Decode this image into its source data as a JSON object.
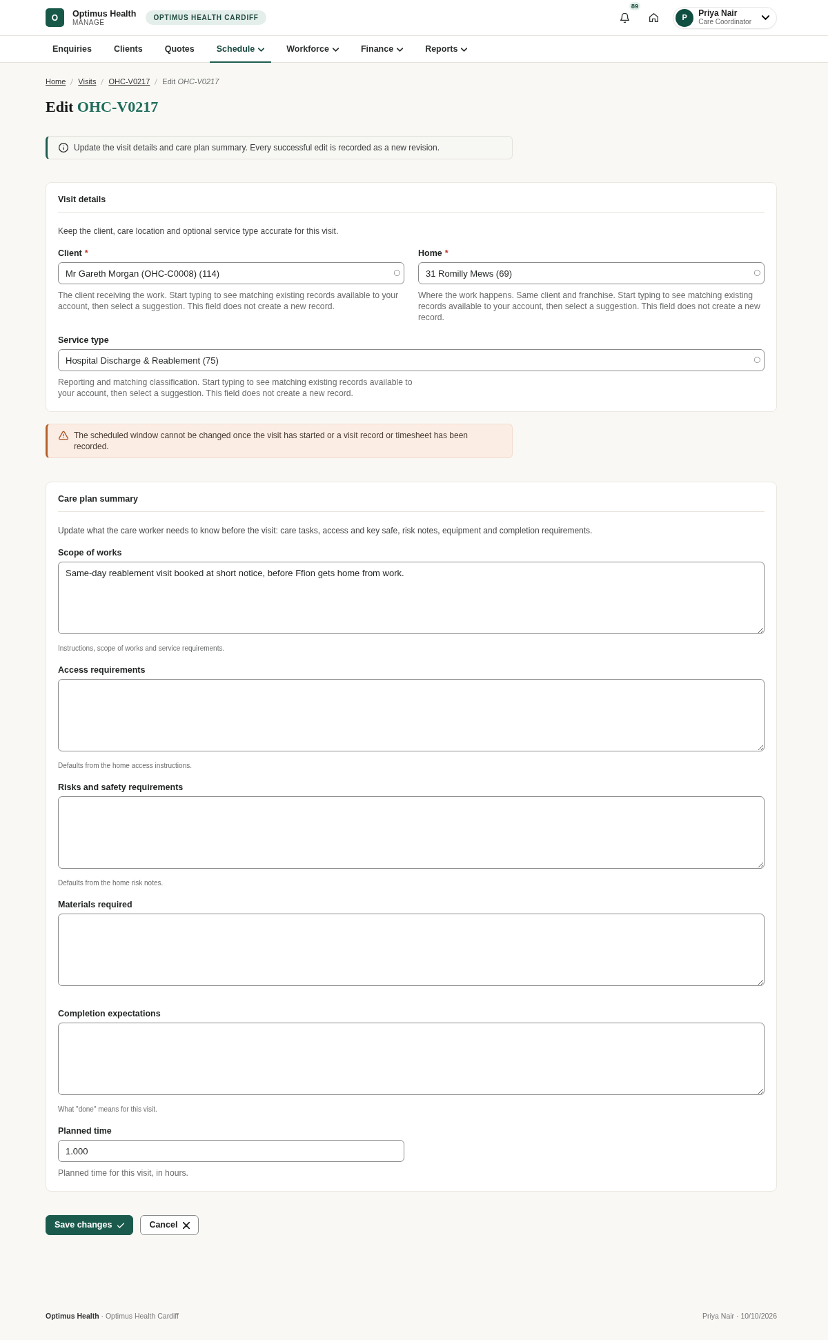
{
  "header": {
    "logo": "O",
    "brand": "Optimus Health",
    "brand_subtitle": "MANAGE",
    "organisation": "OPTIMUS HEALTH CARDIFF",
    "notification_count": "89",
    "user": {
      "initial": "P",
      "name": "Priya Nair",
      "role": "Care Coordinator"
    }
  },
  "nav": [
    {
      "label": "Enquiries",
      "selected": false,
      "has_menu": false
    },
    {
      "label": "Clients",
      "selected": false,
      "has_menu": false
    },
    {
      "label": "Quotes",
      "selected": false,
      "has_menu": false
    },
    {
      "label": "Schedule",
      "selected": true,
      "has_menu": true
    },
    {
      "label": "Workforce",
      "selected": false,
      "has_menu": true
    },
    {
      "label": "Finance",
      "selected": false,
      "has_menu": true
    },
    {
      "label": "Reports",
      "selected": false,
      "has_menu": true
    }
  ],
  "breadcrumb": [
    {
      "label": "Home",
      "kind": "link"
    },
    {
      "label": "Visits",
      "kind": "link"
    },
    {
      "label": "OHC-V0217",
      "kind": "link"
    },
    {
      "label": "Edit *OHC-V0217*",
      "kind": "current"
    }
  ],
  "title": {
    "action": "Edit",
    "reference": "OHC-V0217"
  },
  "info_alert": {
    "kind": "info",
    "text": "Update the visit details and care plan summary. Every successful edit is recorded as a new revision."
  },
  "visit_details": {
    "title": "Visit details",
    "description": "Keep the client, care location and optional service type accurate for this visit.",
    "rows": [
      [
        {
          "label": "Client",
          "required_mark": "*",
          "kind": "lookup",
          "value": "Mr Gareth Morgan (OHC-C0008) (114)",
          "help": "The client receiving the work. Start typing to see matching existing records available to your account, then select a suggestion. This field does not create a new record."
        },
        {
          "label": "Home",
          "required_mark": "*",
          "kind": "lookup",
          "value": "31 Romilly Mews (69)",
          "help": "Where the work happens. Same client and franchise. Start typing to see matching existing records available to your account, then select a suggestion. This field does not create a new record."
        }
      ],
      [
        {
          "label": "Service type",
          "kind": "lookup",
          "value": "Hospital Discharge & Reablement (75)",
          "help": "Reporting and matching classification. Start typing to see matching existing records available to your account, then select a suggestion. This field does not create a new record."
        }
      ]
    ]
  },
  "warning_alert": {
    "kind": "warning",
    "text": "The scheduled window cannot be changed once the visit has started or a visit record or timesheet has been recorded."
  },
  "care_plan": {
    "title": "Care plan summary",
    "description": "Update what the care worker needs to know before the visit: care tasks, access and key safe, risk notes, equipment and completion requirements.",
    "fields": [
      {
        "label": "Scope of works",
        "kind": "textarea",
        "value": "Same-day reablement visit booked at short notice, before Ffion gets home from work.",
        "help": "Instructions, scope of works and service requirements."
      },
      {
        "label": "Access requirements",
        "kind": "textarea",
        "help": "Defaults from the home access instructions."
      },
      {
        "label": "Risks and safety requirements",
        "kind": "textarea",
        "help": "Defaults from the home risk notes."
      },
      {
        "label": "Materials required",
        "kind": "textarea"
      },
      {
        "label": "Completion expectations",
        "kind": "textarea",
        "help": "What \"done\" means for this visit."
      },
      {
        "label": "Planned time",
        "kind": "number",
        "value": "1.000",
        "help": "Planned time for this visit, in hours."
      }
    ]
  },
  "actions": [
    {
      "label": "Save changes",
      "kind": "primary"
    },
    {
      "label": "Cancel",
      "kind": "secondary"
    }
  ],
  "footer": {
    "left": "**Optimus Health** · Optimus Health Cardiff",
    "right": "Priya Nair · 10/10/2026"
  }
}
